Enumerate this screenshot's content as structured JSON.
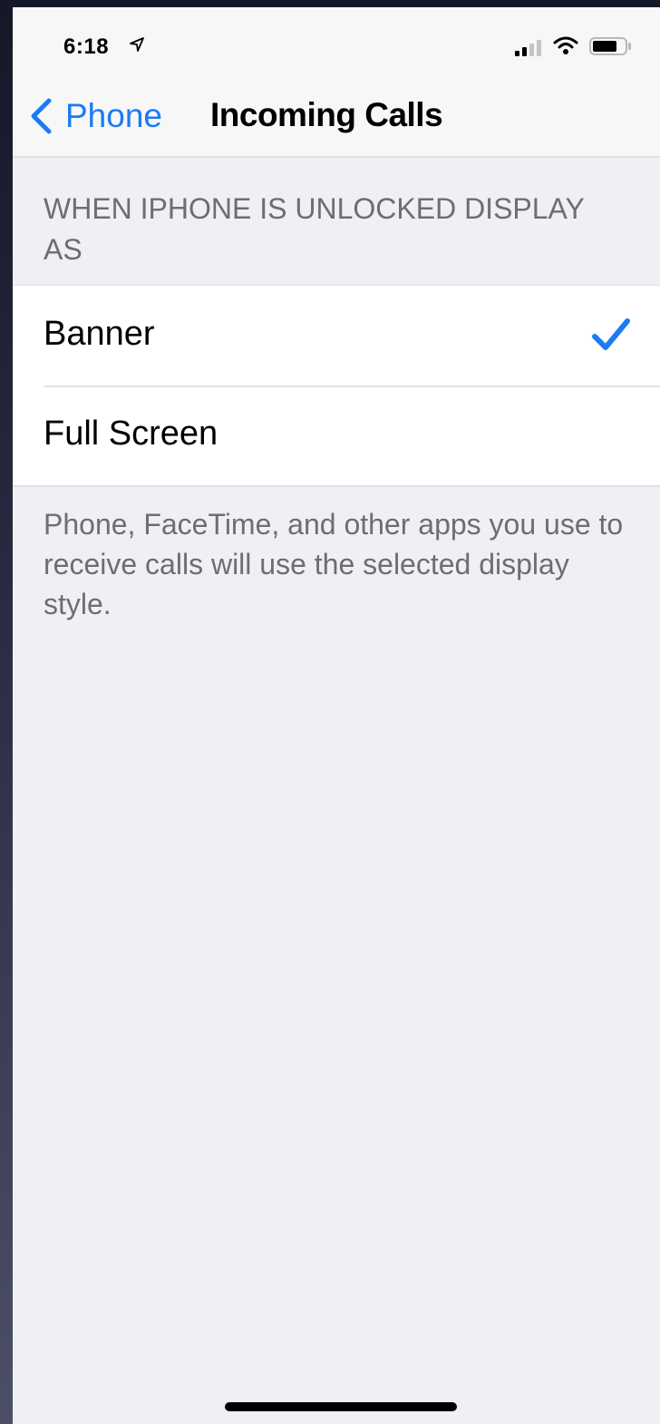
{
  "status_bar": {
    "time": "6:18",
    "icons": [
      "location-arrow-icon",
      "signal-icon",
      "wifi-icon",
      "battery-icon"
    ]
  },
  "nav": {
    "back_label": "Phone",
    "title": "Incoming Calls"
  },
  "section": {
    "header": "WHEN IPHONE IS UNLOCKED DISPLAY AS",
    "options": [
      {
        "label": "Banner",
        "selected": true
      },
      {
        "label": "Full Screen",
        "selected": false
      }
    ],
    "footer": "Phone, FaceTime, and other apps you use to receive calls will use the selected display style."
  },
  "colors": {
    "accent": "#1a7cf3",
    "background": "#efeff4",
    "secondary_text": "#6d6d72"
  }
}
